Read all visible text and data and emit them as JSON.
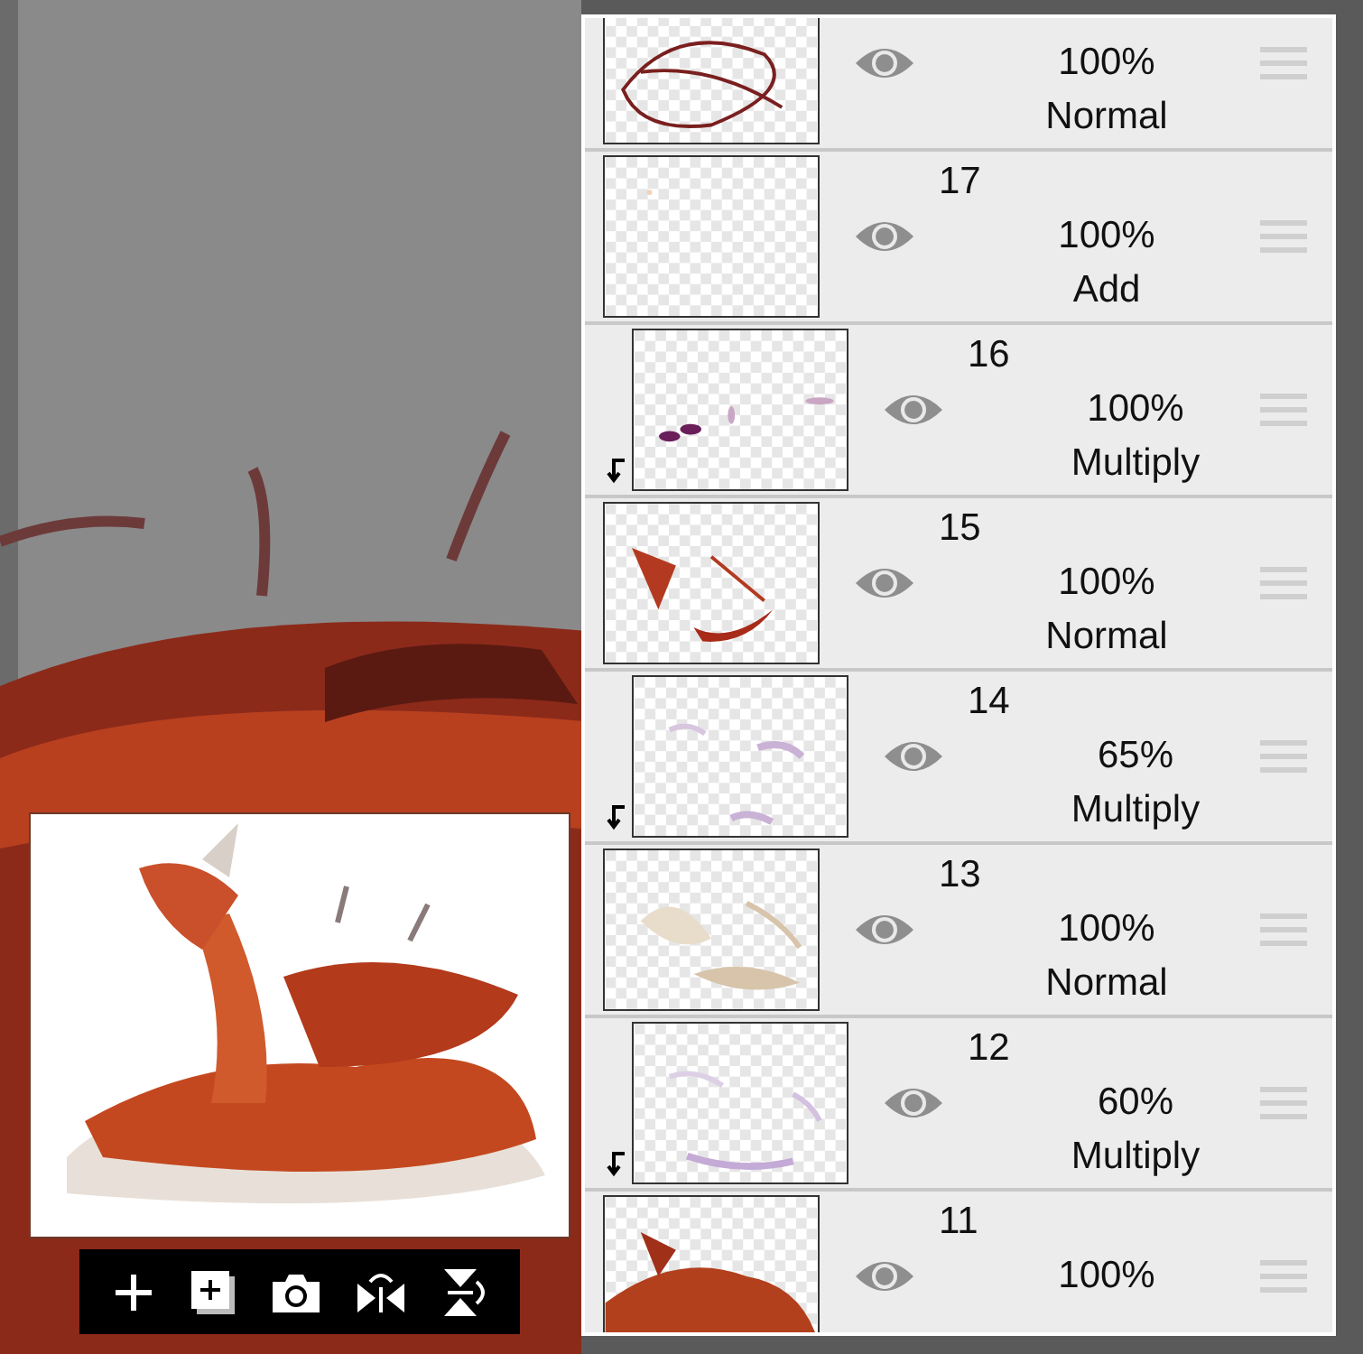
{
  "layers": [
    {
      "opacity": "100%",
      "blend": "Normal",
      "clipped": false
    },
    {
      "number": "17",
      "opacity": "100%",
      "blend": "Add",
      "clipped": false
    },
    {
      "number": "16",
      "opacity": "100%",
      "blend": "Multiply",
      "clipped": true
    },
    {
      "number": "15",
      "opacity": "100%",
      "blend": "Normal",
      "clipped": false
    },
    {
      "number": "14",
      "opacity": "65%",
      "blend": "Multiply",
      "clipped": true
    },
    {
      "number": "13",
      "opacity": "100%",
      "blend": "Normal",
      "clipped": false
    },
    {
      "number": "12",
      "opacity": "60%",
      "blend": "Multiply",
      "clipped": true
    },
    {
      "number": "11",
      "opacity": "100%",
      "clipped": false
    }
  ]
}
